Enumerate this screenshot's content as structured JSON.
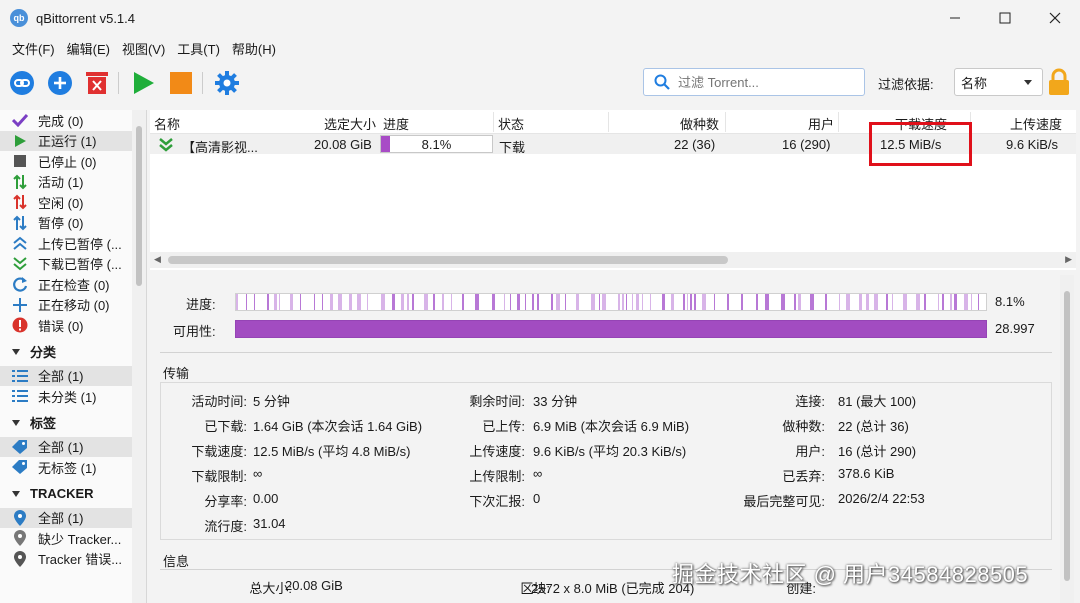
{
  "window": {
    "title": "qBittorrent v5.1.4",
    "app_icon_text": "qb"
  },
  "menu": [
    "文件(F)",
    "编辑(E)",
    "视图(V)",
    "工具(T)",
    "帮助(H)"
  ],
  "toolbar": {
    "search_placeholder": "过滤 Torrent...",
    "filter_label": "过滤依据:",
    "filter_value": "名称"
  },
  "sidebar": {
    "status": [
      {
        "label": "完成 (0)",
        "icon": "check-icon",
        "color": "#7b3fc4"
      },
      {
        "label": "正运行 (1)",
        "icon": "play-icon",
        "color": "#2e9e3a",
        "selected": true
      },
      {
        "label": "已停止 (0)",
        "icon": "stop-square-icon",
        "color": "#555555"
      },
      {
        "label": "活动 (1)",
        "icon": "updown-arrows-icon",
        "color": "#2e9e3a"
      },
      {
        "label": "空闲 (0)",
        "icon": "updown-arrows-icon",
        "color": "#d9332b"
      },
      {
        "label": "暂停 (0)",
        "icon": "updown-arrows-icon",
        "color": "#2c7cc4"
      },
      {
        "label": "上传已暂停 (...",
        "icon": "double-chevron-up-icon",
        "color": "#2c7cc4"
      },
      {
        "label": "下载已暂停 (...",
        "icon": "double-chevron-down-icon",
        "color": "#2e9e3a"
      },
      {
        "label": "正在检查 (0)",
        "icon": "refresh-icon",
        "color": "#2c7cc4"
      },
      {
        "label": "正在移动 (0)",
        "icon": "move-icon",
        "color": "#2c7cc4"
      },
      {
        "label": "错误 (0)",
        "icon": "error-icon",
        "color": "#d9332b"
      }
    ],
    "categories_header": "分类",
    "categories": [
      {
        "label": "全部 (1)",
        "selected": true
      },
      {
        "label": "未分类 (1)"
      }
    ],
    "tags_header": "标签",
    "tags": [
      {
        "label": "全部 (1)",
        "selected": true
      },
      {
        "label": "无标签 (1)"
      }
    ],
    "trackers_header": "TRACKER",
    "trackers": [
      {
        "label": "全部 (1)",
        "selected": true
      },
      {
        "label": "缺少 Tracker..."
      },
      {
        "label": "Tracker 错误..."
      }
    ]
  },
  "list": {
    "columns": [
      "名称",
      "选定大小",
      "进度",
      "状态",
      "做种数",
      "用户",
      "下载速度",
      "上传速度"
    ],
    "rows": [
      {
        "name": "【高清影视...",
        "size": "20.08 GiB",
        "progress_text": "8.1%",
        "progress": 0.081,
        "status": "下载",
        "seeds": "22 (36)",
        "peers": "16 (290)",
        "down_speed": "12.5 MiB/s",
        "up_speed": "9.6 KiB/s"
      }
    ]
  },
  "props": {
    "progress_label": "进度:",
    "progress_value": "8.1%",
    "availability_label": "可用性:",
    "availability_value": "28.997",
    "transfer_title": "传输",
    "info_title": "信息",
    "transfer": {
      "col1": [
        {
          "k": "活动时间:",
          "v": "5 分钟"
        },
        {
          "k": "已下载:",
          "v": "1.64 GiB (本次会话 1.64 GiB)"
        },
        {
          "k": "下载速度:",
          "v": "12.5 MiB/s (平均 4.8 MiB/s)"
        },
        {
          "k": "下载限制:",
          "v": "∞"
        },
        {
          "k": "分享率:",
          "v": "0.00"
        },
        {
          "k": "流行度:",
          "v": "31.04"
        }
      ],
      "col2": [
        {
          "k": "剩余时间:",
          "v": "33 分钟"
        },
        {
          "k": "已上传:",
          "v": "6.9 MiB (本次会话 6.9 MiB)"
        },
        {
          "k": "上传速度:",
          "v": "9.6 KiB/s (平均 20.3 KiB/s)"
        },
        {
          "k": "上传限制:",
          "v": "∞"
        },
        {
          "k": "下次汇报:",
          "v": "0"
        }
      ],
      "col3": [
        {
          "k": "连接:",
          "v": "81 (最大 100)"
        },
        {
          "k": "做种数:",
          "v": "22 (总计 36)"
        },
        {
          "k": "用户:",
          "v": "16 (总计 290)"
        },
        {
          "k": "已丢弃:",
          "v": "378.6 KiB"
        },
        {
          "k": "最后完整可见:",
          "v": "2026/2/4 22:53"
        }
      ]
    },
    "info": {
      "total_size_label": "总大小:",
      "total_size": "20.08 GiB",
      "pieces_label": "区块:",
      "pieces": "2572 x 8.0 MiB (已完成 204)",
      "created_label": "创建:"
    }
  },
  "watermark": "掘金技术社区 @ 用户34584828505",
  "colors": {
    "accent": "#a24cc1",
    "highlight": "#e0101a",
    "selection": "#e3e3e3"
  }
}
